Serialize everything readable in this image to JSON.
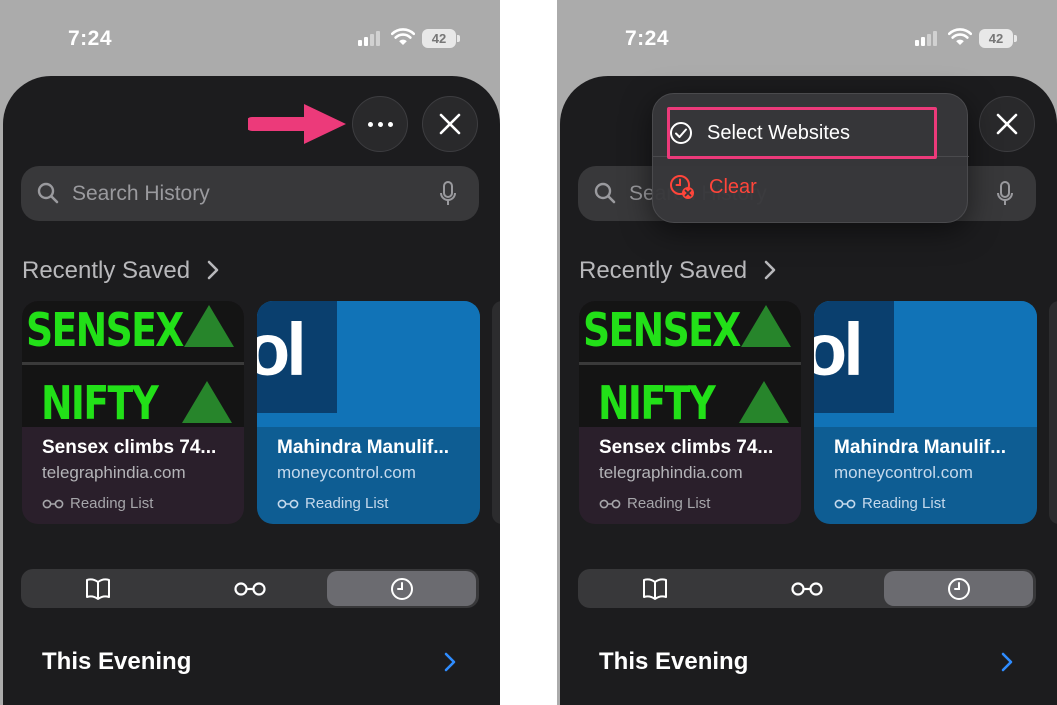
{
  "status_bar": {
    "time": "7:24",
    "battery": "42"
  },
  "search": {
    "placeholder": "Search History"
  },
  "recently_saved": {
    "title": "Recently Saved",
    "cards": [
      {
        "title": "Sensex climbs 74...",
        "domain": "telegraphindia.com",
        "badge": "Reading List",
        "thumb_text_1": "SENSEX",
        "thumb_text_2": "NIFTY"
      },
      {
        "title": "Mahindra Manulif...",
        "domain": "moneycontrol.com",
        "badge": "Reading List",
        "thumb_text": "ol"
      }
    ]
  },
  "segments": {
    "items": [
      "bookmarks-icon",
      "reading-list-icon",
      "history-icon"
    ],
    "selected": 2
  },
  "section": {
    "title": "This Evening"
  },
  "popover": {
    "select_label": "Select Websites",
    "clear_label": "Clear"
  },
  "colors": {
    "accent_link": "#2f8cff",
    "destructive": "#ff453a",
    "annotation_pink": "#ec3a7a",
    "sheet_bg": "#1c1c1e"
  }
}
